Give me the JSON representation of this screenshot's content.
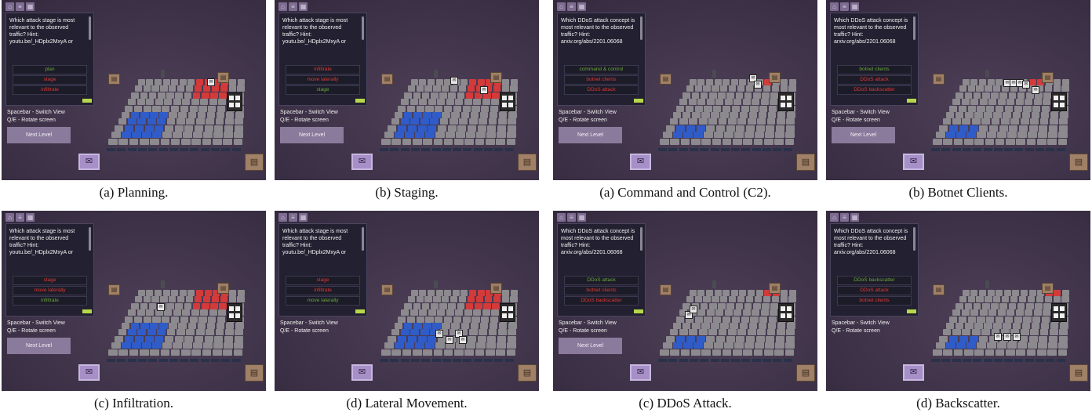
{
  "colors": {
    "correct": "#6aa83d",
    "wrong": "#dd3a35",
    "blue_tile": "#2f5cc8",
    "red_tile": "#d33a3a",
    "panel_bg": "#3a2f44"
  },
  "icons": [
    "home-icon",
    "list-icon",
    "grid-icon",
    "envelope-icon",
    "crate-icon"
  ],
  "panels": [
    {
      "caption": "(a) Planning.",
      "question": "Which attack stage is most relevant to the observed traffic? Hint: youtu.be/_HDplx2MxyA or",
      "options": [
        {
          "label": "plan",
          "state": "ok"
        },
        {
          "label": "stage",
          "state": "bad"
        },
        {
          "label": "infiltrate",
          "state": "bad"
        }
      ],
      "controls": {
        "switch_view": "Spacebar - Switch View",
        "rotate": "Q/E - Rotate screen"
      },
      "next_button": "Next Level"
    },
    {
      "caption": "(b) Staging.",
      "question": "Which attack stage is most relevant to the observed traffic? Hint: youtu.be/_HDplx2MxyA or",
      "options": [
        {
          "label": "infiltrate",
          "state": "bad"
        },
        {
          "label": "move laterally",
          "state": "bad"
        },
        {
          "label": "stage",
          "state": "ok"
        }
      ],
      "controls": {
        "switch_view": "Spacebar - Switch View",
        "rotate": "Q/E - Rotate screen"
      },
      "next_button": "Next Level"
    },
    {
      "caption": "(a) Command and Control (C2).",
      "question": "Which DDoS attack concept is most relevant to the observed traffic? Hint: arxiv.org/abs/2201.06068",
      "options": [
        {
          "label": "command & control",
          "state": "ok"
        },
        {
          "label": "botnet clients",
          "state": "bad"
        },
        {
          "label": "DDoS attack",
          "state": "bad"
        }
      ],
      "controls": {
        "switch_view": "Spacebar - Switch View",
        "rotate": "Q/E - Rotate screen"
      },
      "next_button": "Next Level"
    },
    {
      "caption": "(b) Botnet Clients.",
      "question": "Which DDoS attack concept is most relevant to the observed traffic? Hint: arxiv.org/abs/2201.06068",
      "options": [
        {
          "label": "botnet clients",
          "state": "ok"
        },
        {
          "label": "DDoS attack",
          "state": "bad"
        },
        {
          "label": "DDoS backscatter",
          "state": "bad"
        }
      ],
      "controls": {
        "switch_view": "Spacebar - Switch View",
        "rotate": "Q/E - Rotate screen"
      },
      "next_button": "Next Level"
    },
    {
      "caption": "(c) Infiltration.",
      "question": "Which attack stage is most relevant to the observed traffic? Hint: youtu.be/_HDplx2MxyA or",
      "options": [
        {
          "label": "stage",
          "state": "bad"
        },
        {
          "label": "move laterally",
          "state": "bad"
        },
        {
          "label": "infiltrate",
          "state": "ok"
        }
      ],
      "controls": {
        "switch_view": "Spacebar - Switch View",
        "rotate": "Q/E - Rotate screen"
      },
      "next_button": "Next Level"
    },
    {
      "caption": "(d) Lateral Movement.",
      "question": "Which attack stage is most relevant to the observed traffic? Hint: youtu.be/_HDplx2MxyA or",
      "options": [
        {
          "label": "stage",
          "state": "bad"
        },
        {
          "label": "infiltrate",
          "state": "bad"
        },
        {
          "label": "move laterally",
          "state": "ok"
        }
      ],
      "controls": {
        "switch_view": "Spacebar - Switch View",
        "rotate": "Q/E - Rotate screen"
      },
      "next_button": null
    },
    {
      "caption": "(c) DDoS Attack.",
      "question": "Which DDoS attack concept is most relevant to the observed traffic? Hint: arxiv.org/abs/2201.06068",
      "options": [
        {
          "label": "DDoS attack",
          "state": "ok"
        },
        {
          "label": "botnet clients",
          "state": "bad"
        },
        {
          "label": "DDoS backscatter",
          "state": "bad"
        }
      ],
      "controls": {
        "switch_view": "Spacebar - Switch View",
        "rotate": "Q/E - Rotate screen"
      },
      "next_button": "Next Level"
    },
    {
      "caption": "(d) Backscatter.",
      "question": "Which DDoS attack concept is most relevant to the observed traffic? Hint: arxiv.org/abs/2201.06068",
      "options": [
        {
          "label": "DDoS backscatter",
          "state": "ok"
        },
        {
          "label": "DDoS attack",
          "state": "bad"
        },
        {
          "label": "botnet clients",
          "state": "bad"
        }
      ],
      "controls": {
        "switch_view": "Spacebar - Switch View",
        "rotate": "Q/E - Rotate screen"
      },
      "next_button": null
    }
  ]
}
